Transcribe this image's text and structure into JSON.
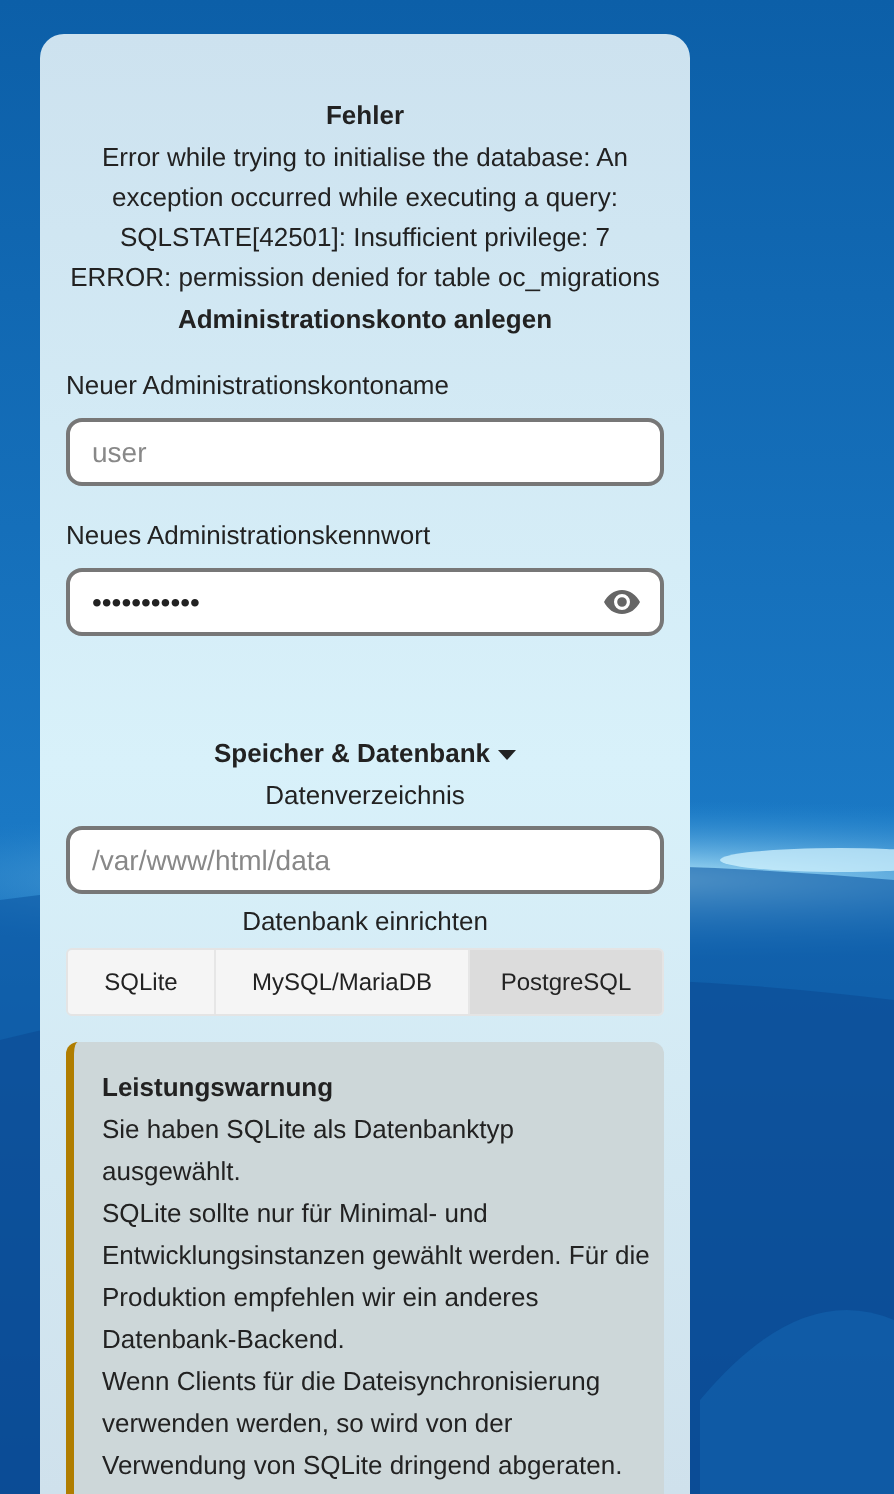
{
  "error": {
    "title": "Fehler",
    "message": "Error while trying to initialise the database: An exception occurred while executing a query: SQLSTATE[42501]: Insufficient privilege: 7 ERROR: permission denied for table oc_migrations"
  },
  "heading": "Administrationskonto anlegen",
  "fields": [
    {
      "label": "Neuer Administrationskontoname",
      "kind": "text",
      "placeholder": "user"
    },
    {
      "label": "Neues Administrationskennwort",
      "kind": "password",
      "value": "•••••••••••"
    }
  ],
  "storage": {
    "toggle": "Speicher & Datenbank",
    "expanded": true,
    "data_dir_label": "Datenverzeichnis",
    "data_dir_placeholder": "/var/www/html/data",
    "db_label": "Datenbank einrichten"
  },
  "db_tabs": [
    {
      "label": "SQLite",
      "selected": false
    },
    {
      "label": "MySQL/MariaDB",
      "selected": false
    },
    {
      "label": "PostgreSQL",
      "selected": true
    }
  ],
  "warning": {
    "title": "Leistungswarnung",
    "paragraphs": [
      "Sie haben SQLite als Datenbanktyp ausgewählt.",
      "SQLite sollte nur für Minimal- und Entwicklungsinstanzen gewählt werden. Für die Produktion empfehlen wir ein anderes Datenbank-Backend.",
      "Wenn Clients für die Dateisynchronisierung verwenden werden, so wird von der Verwendung von SQLite dringend abgeraten."
    ]
  }
}
